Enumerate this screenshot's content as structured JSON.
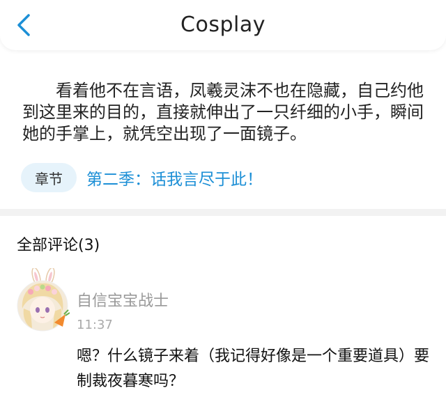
{
  "header": {
    "title": "Cosplay",
    "back_icon": "chevron-left-icon",
    "accent_color": "#1c8fd6"
  },
  "excerpt": {
    "text": "看着他不在言语，凤羲灵沫不也在隐藏，自己约他到这里来的目的，直接就伸出了一只纤细的小手，瞬间她的手掌上，就凭空出现了一面镜子。"
  },
  "chapter": {
    "tag_label": "章节",
    "title": "第二季：话我言尽于此！"
  },
  "comments": {
    "header": "全部评论(3)",
    "items": [
      {
        "username": "自信宝宝战士",
        "time": "11:37",
        "text": "嗯？什么镜子来着（我记得好像是一个重要道具）要制裁夜暮寒吗？",
        "avatar_icon": "bunny-girl-avatar"
      }
    ]
  }
}
